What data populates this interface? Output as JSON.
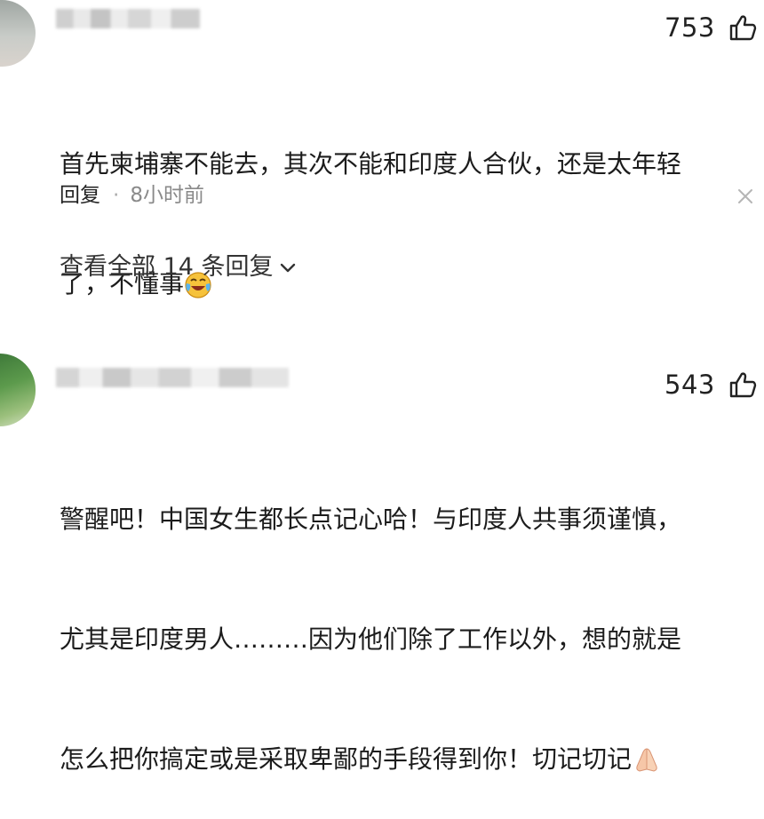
{
  "comments": [
    {
      "likes": "753",
      "text_line1": "首先柬埔寨不能去，其次不能和印度人合伙，还是太年轻",
      "text_line2": "了，不懂事",
      "emoji": "laughing-crying-emoji",
      "reply_label": "回复",
      "separator": "·",
      "time": "8小时前",
      "view_replies": "查看全部 14 条回复"
    },
    {
      "likes": "543",
      "text_line1": "警醒吧！中国女生都长点记心哈！与印度人共事须谨慎，",
      "text_line2": "尤其是印度男人………因为他们除了工作以外，想的就是",
      "text_line3": "怎么把你搞定或是采取卑鄙的手段得到你！切记切记",
      "emoji": "praying-hands-emoji"
    }
  ],
  "icons": {
    "like": "thumbs-up-icon",
    "close": "close-icon",
    "expand": "chevron-down-icon"
  }
}
